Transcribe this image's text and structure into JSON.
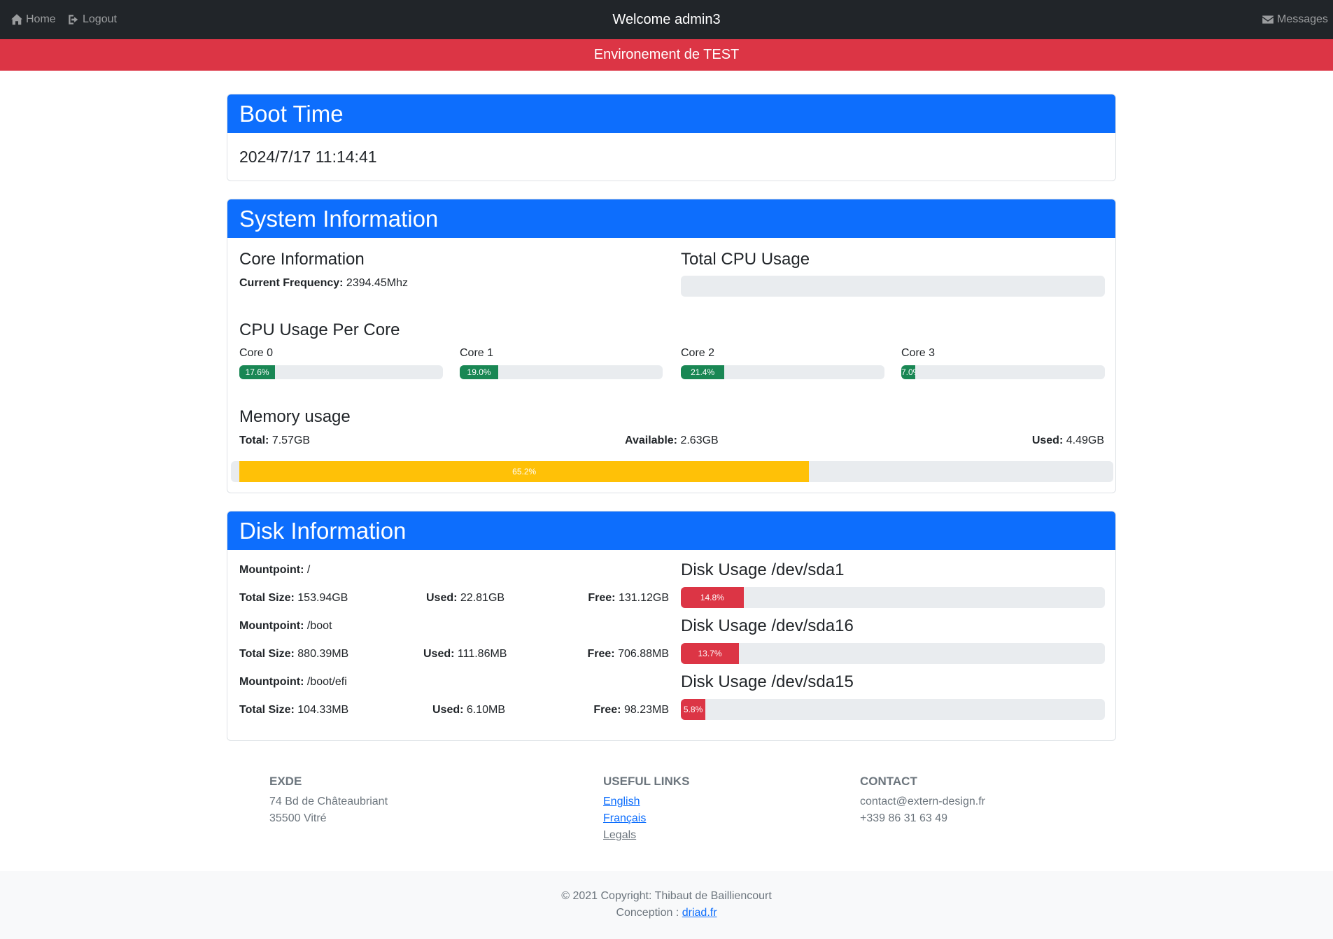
{
  "nav": {
    "home_label": "Home",
    "logout_label": "Logout",
    "welcome": "Welcome admin3",
    "messages_label": "Messages"
  },
  "env_banner": "Environement de TEST",
  "boot": {
    "title": "Boot Time",
    "value": "2024/7/17 11:14:41"
  },
  "system": {
    "title": "System Information",
    "core_info_title": "Core Information",
    "freq_label": "Current Frequency:",
    "freq_value": "2394.45Mhz",
    "total_cpu_title": "Total CPU Usage",
    "total_cpu_percent": 0,
    "per_core_title": "CPU Usage Per Core",
    "cores": [
      {
        "label": "Core 0",
        "percent": 17.6,
        "text": "17.6%"
      },
      {
        "label": "Core 1",
        "percent": 19.0,
        "text": "19.0%"
      },
      {
        "label": "Core 2",
        "percent": 21.4,
        "text": "21.4%"
      },
      {
        "label": "Core 3",
        "percent": 7.0,
        "text": "7.0%"
      }
    ],
    "memory_title": "Memory usage",
    "mem_total_label": "Total:",
    "mem_total": "7.57GB",
    "mem_available_label": "Available:",
    "mem_available": "2.63GB",
    "mem_used_label": "Used:",
    "mem_used": "4.49GB",
    "mem_percent": 65.2,
    "mem_text": "65.2%"
  },
  "disk": {
    "title": "Disk Information",
    "mountpoint_label": "Mountpoint:",
    "total_label": "Total Size:",
    "used_label": "Used:",
    "free_label": "Free:",
    "mounts": [
      {
        "mountpoint": "/",
        "total": "153.94GB",
        "used": "22.81GB",
        "free": "131.12GB"
      },
      {
        "mountpoint": "/boot",
        "total": "880.39MB",
        "used": "111.86MB",
        "free": "706.88MB"
      },
      {
        "mountpoint": "/boot/efi",
        "total": "104.33MB",
        "used": "6.10MB",
        "free": "98.23MB"
      }
    ],
    "usages": [
      {
        "title": "Disk Usage /dev/sda1",
        "percent": 14.8,
        "text": "14.8%"
      },
      {
        "title": "Disk Usage /dev/sda16",
        "percent": 13.7,
        "text": "13.7%"
      },
      {
        "title": "Disk Usage /dev/sda15",
        "percent": 5.8,
        "text": "5.8%"
      }
    ]
  },
  "footer": {
    "company_title": "EXDE",
    "address_line1": "74 Bd de Châteaubriant",
    "address_line2": "35500 Vitré",
    "links_title": "USEFUL LINKS",
    "link_english": "English",
    "link_francais": "Français",
    "link_legals": "Legals",
    "contact_title": "CONTACT",
    "contact_email": "contact@extern-design.fr",
    "contact_phone": "+339 86 31 63 49",
    "copyright": "© 2021 Copyright: Thibaut de Bailliencourt",
    "conception_label": "Conception : ",
    "conception_link": "driad.fr"
  },
  "colors": {
    "primary": "#0d6efd",
    "danger": "#dc3545",
    "success": "#198754",
    "warning": "#ffc107",
    "dark": "#212529"
  }
}
